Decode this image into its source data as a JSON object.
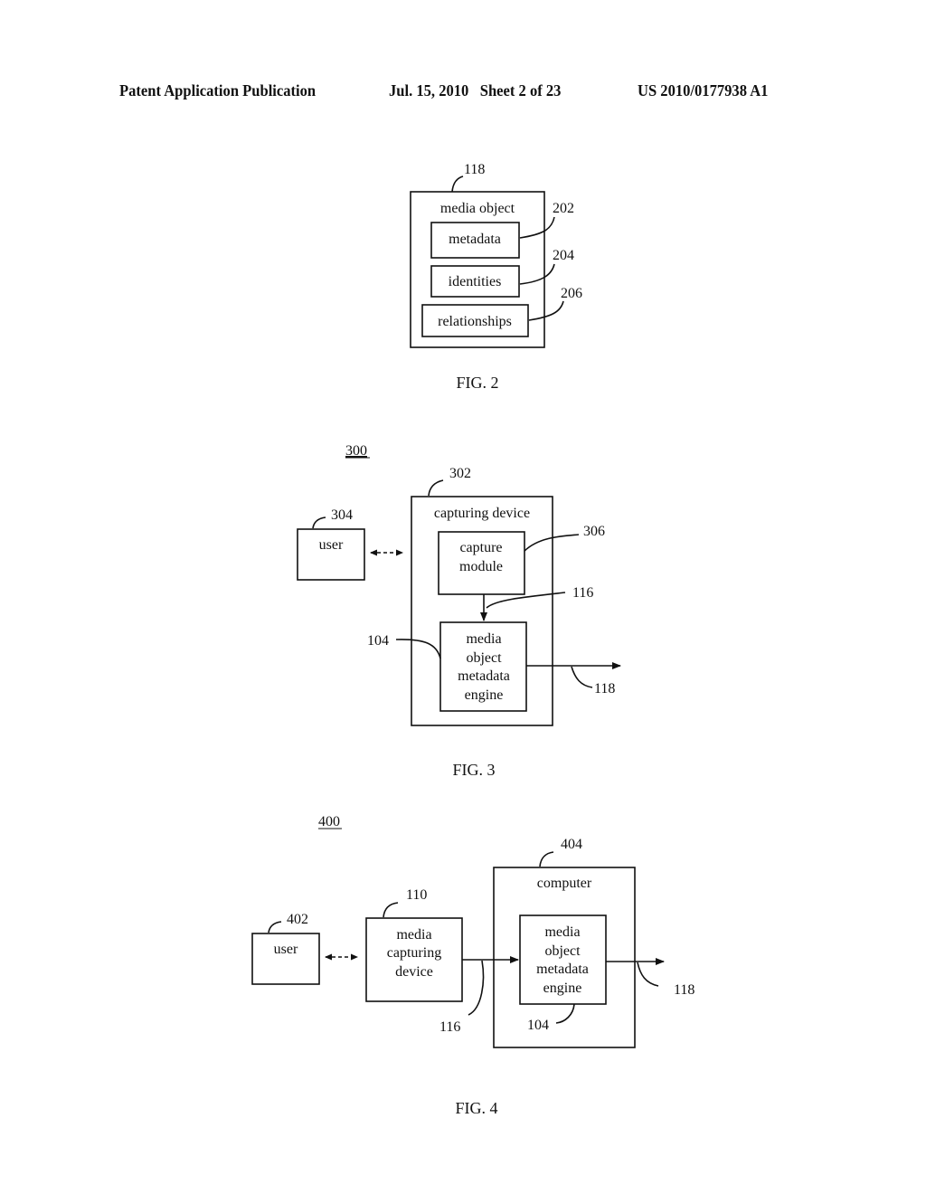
{
  "header": {
    "left": "Patent Application Publication",
    "date_sheet": "Jul. 15, 2010   Sheet 2 of 23",
    "number": "US 2010/0177938 A1"
  },
  "fig2": {
    "caption": "FIG. 2",
    "ref_outer": "118",
    "outer_label": "media object",
    "boxes": [
      {
        "label": "metadata",
        "ref": "202"
      },
      {
        "label": "identities",
        "ref": "204"
      },
      {
        "label": "relationships",
        "ref": "206"
      }
    ]
  },
  "fig3": {
    "caption": "FIG. 3",
    "ref_figure": "300",
    "device": {
      "label": "capturing device",
      "ref": "302"
    },
    "user": {
      "label": "user",
      "ref": "304"
    },
    "capture_module": {
      "line1": "capture",
      "line2": "module",
      "ref": "306"
    },
    "engine": {
      "lines": [
        "media",
        "object",
        "metadata",
        "engine"
      ],
      "ref": "104"
    },
    "arrow_ref": "116",
    "output_ref": "118"
  },
  "fig4": {
    "caption": "FIG. 4",
    "ref_figure": "400",
    "user": {
      "label": "user",
      "ref": "402"
    },
    "capturing_device": {
      "lines": [
        "media",
        "capturing",
        "device"
      ],
      "ref": "110"
    },
    "computer": {
      "label": "computer",
      "ref": "404"
    },
    "engine": {
      "lines": [
        "media",
        "object",
        "metadata",
        "engine"
      ],
      "ref": "104"
    },
    "arrow_ref": "116",
    "output_ref": "118"
  }
}
